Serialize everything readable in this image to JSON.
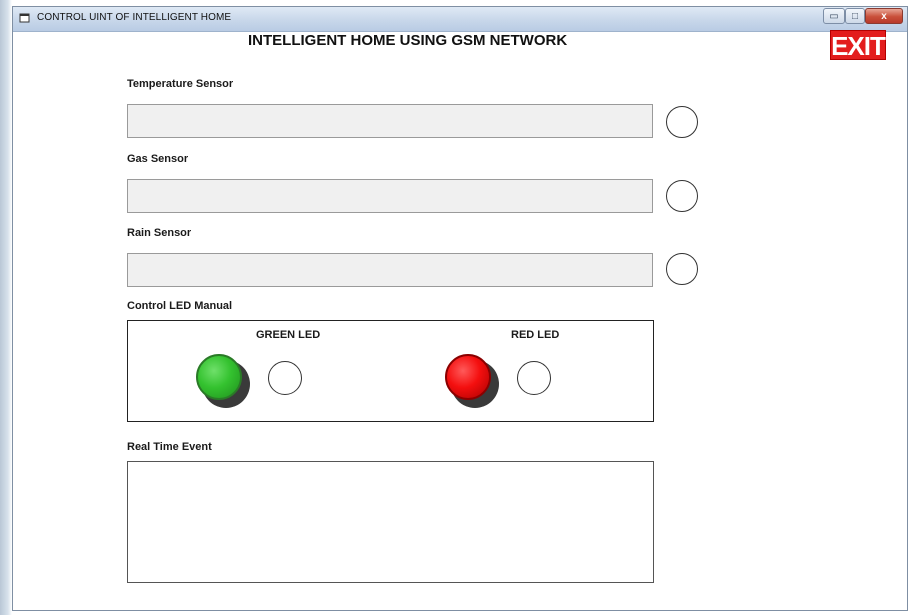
{
  "window": {
    "title": "CONTROL UINT OF INTELLIGENT HOME",
    "min_glyph": "▭",
    "max_glyph": "□",
    "close_glyph": "x"
  },
  "header": {
    "title": "INTELLIGENT HOME USING GSM NETWORK",
    "exit_label": "EXIT",
    "exit_color": "#e31d1d"
  },
  "sensors": {
    "temperature_label": "Temperature Sensor",
    "temperature_value": "",
    "gas_label": "Gas Sensor",
    "gas_value": "",
    "rain_label": "Rain Sensor",
    "rain_value": ""
  },
  "led_control": {
    "section_label": "Control LED Manual",
    "green_label": "GREEN LED",
    "red_label": "RED LED",
    "green_color": "#34c22f",
    "red_color": "#f40f0f"
  },
  "events": {
    "section_label": "Real Time Event",
    "content": ""
  }
}
